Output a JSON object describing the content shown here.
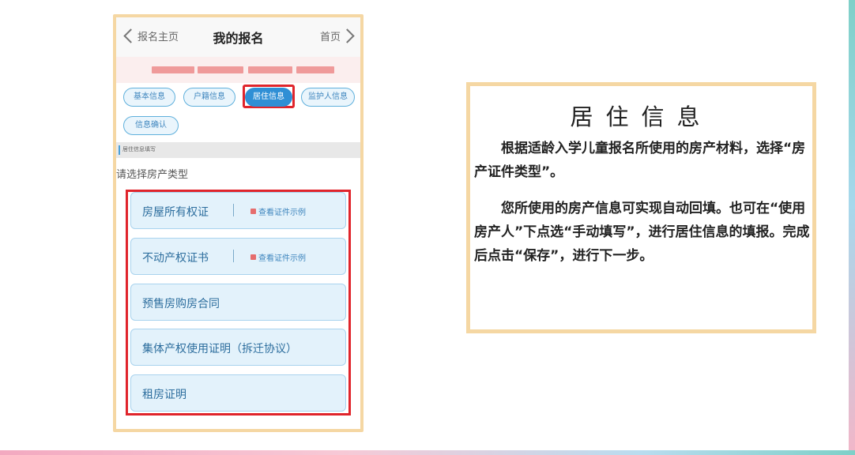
{
  "nav": {
    "back_label": "报名主页",
    "title": "我的报名",
    "home_label": "首页"
  },
  "tabs": [
    {
      "label": "基本信息",
      "active": false
    },
    {
      "label": "户籍信息",
      "active": false
    },
    {
      "label": "居住信息",
      "active": true
    },
    {
      "label": "监护人信息",
      "active": false
    },
    {
      "label": "信息确认",
      "active": false
    }
  ],
  "section": {
    "header": "居住信息填写",
    "prompt": "请选择房产类型"
  },
  "property_types": [
    {
      "label": "房屋所有权证",
      "example": "查看证件示例"
    },
    {
      "label": "不动产权证书",
      "example": "查看证件示例"
    },
    {
      "label": "预售房购房合同"
    },
    {
      "label": "集体产权使用证明（拆迁协议）"
    },
    {
      "label": "租房证明"
    }
  ],
  "info": {
    "title": "居住信息",
    "para1": "　　根据适龄入学儿童报名所使用的房产材料，选择“房产证件类型”。",
    "para2": "　　您所使用的房产信息可实现自动回填。也可在“使用房产人”下点选“手动填写”，进行居住信息的填报。完成后点击“保存”，进行下一步。"
  }
}
